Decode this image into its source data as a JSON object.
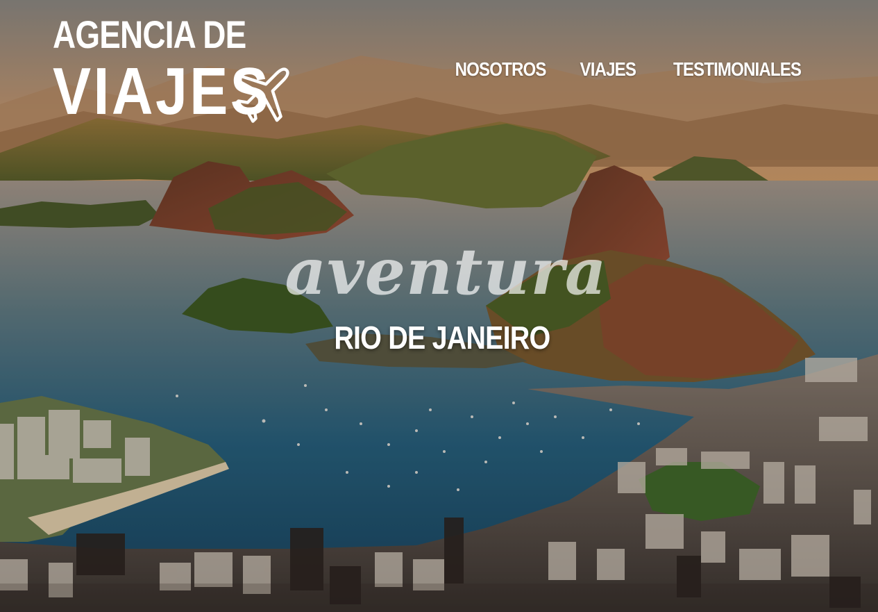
{
  "logo": {
    "line1": "AGENCIA DE",
    "line2": "VIAJES",
    "icon": "airplane-icon"
  },
  "nav": {
    "items": [
      {
        "label": "NOSOTROS"
      },
      {
        "label": "VIAJES"
      },
      {
        "label": "TESTIMONIALES"
      }
    ]
  },
  "hero": {
    "script_text": "aventura",
    "city": "RIO DE JANEIRO"
  },
  "colors": {
    "text": "#ffffff",
    "sky": "#c9a27a",
    "water": "#2f6f8f",
    "hills": "#5f6a2e"
  }
}
